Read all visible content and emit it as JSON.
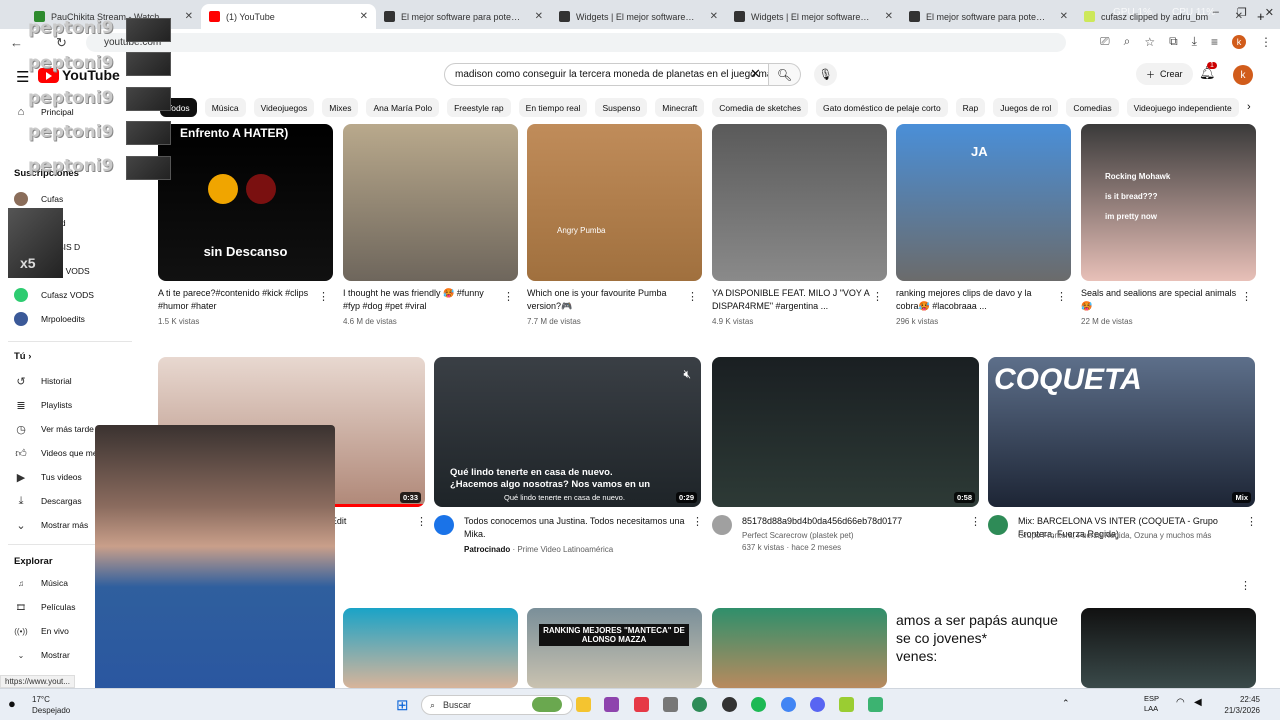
{
  "tabs": [
    {
      "title": "PauChikita Stream - Watch Live",
      "color": "#2e8b2e"
    },
    {
      "title": "(1) YouTube",
      "color": "#ff0000",
      "active": true
    },
    {
      "title": "El mejor software para potencia",
      "color": "#333333"
    },
    {
      "title": "Widgets | El mejor software pa",
      "color": "#333333"
    },
    {
      "title": "Widgets | El mejor software pa",
      "color": "#333333"
    },
    {
      "title": "El mejor software para potencia",
      "color": "#333333"
    },
    {
      "title": "cufasz clipped by adru_bm",
      "color": "#cde85a"
    }
  ],
  "overlay_stats": {
    "gpu": "GPU 1%",
    "cpu": "CPU 11%"
  },
  "address": {
    "url": "youtube.com",
    "profile": "k"
  },
  "header": {
    "logo_text": "YouTube",
    "search_value": "madison como conseguir la tercera moneda de planetas en el juego ma",
    "create_label": "Crear",
    "notif_count": "1",
    "avatar_letter": "k"
  },
  "chips": [
    "Todos",
    "Música",
    "Videojuegos",
    "Mixes",
    "Ana María Polo",
    "Freestyle rap",
    "En tiempo real",
    "Suspenso",
    "Minecraft",
    "Comedia de sketches",
    "Gato doméstico de pelaje corto",
    "Rap",
    "Juegos de rol",
    "Comedias",
    "Videojuego independiente"
  ],
  "sidebar": {
    "principal": "Principal",
    "subs_head": "Suscripciones",
    "subs": [
      "Cufas",
      "Speed",
      "TENSIS D",
      "Cufas VODS",
      "Cufasz VODS",
      "Mrpoloedits"
    ],
    "tu_head": "Tú",
    "tu": [
      "Historial",
      "Playlists",
      "Ver más tarde",
      "Videos que me gus...",
      "Tus videos",
      "Descargas",
      "Mostrar más"
    ],
    "explorar_head": "Explorar",
    "explorar": [
      "Música",
      "Películas",
      "En vivo",
      "Mostrar"
    ]
  },
  "shorts": [
    {
      "title": "A  ti te parece?#contenido #kick #clips #humor #hater",
      "views": "1.5 K vistas",
      "overlay_top": "Enfrento A HATER)",
      "overlay_bottom": "sin Descanso"
    },
    {
      "title": "I thought he was friendly 🥵 #funny #fyp #dog #pet #viral",
      "views": "4.6 M de vistas"
    },
    {
      "title": "Which one is your favourite Pumba version?🎮",
      "views": "7.7 M de vistas",
      "overlay": "Angry Pumba"
    },
    {
      "title": "YA DISPONIBLE FEAT. MILO J \"VOY A DISPAR4RME\" #argentina ...",
      "views": "4.9 K vistas"
    },
    {
      "title": "ranking mejores clips de davo y la cobra🥵 #lacobraaa ...",
      "views": "296 k vistas",
      "overlay": "JA"
    },
    {
      "title": "Seals and sealions are special animals 🥵",
      "views": "22 M de vistas",
      "overlay": [
        "Rocking Mohawk",
        "is it bread???",
        "im pretty now"
      ]
    }
  ],
  "videos": [
    {
      "title": "...) | Edit",
      "duration": "0:33"
    },
    {
      "title": "Todos conocemos una Justina. Todos necesitamos una Mika.",
      "sponsored": "Patrocinado",
      "channel": "Prime Video Latinoamérica",
      "duration": "0:29",
      "caption1": "Qué lindo tenerte en casa de nuevo.",
      "caption2": "¿Hacemos algo nosotras? Nos vamos en un",
      "caption3": "Qué lindo tenerte en casa de nuevo."
    },
    {
      "title": "85178d88a9bd4b0da456d66eb78d0177",
      "channel": "Perfect Scarecrow (plastek pet)",
      "meta": "637 k vistas · hace 2 meses",
      "duration": "0:58"
    },
    {
      "title": "Mix: BARCELONA VS INTER (COQUETA - Grupo Frontera, Fuerza Regida)",
      "channel": "Grupo Frontera, Fuerza Regida, Ozuna y muchos más",
      "duration": "Mix",
      "overlay": "COQUETA"
    }
  ],
  "row3_overlay": {
    "ranking": "RANKING MEJORES \"MANTECA\" DE ALONSO MAZZA",
    "text": "amos a ser papás aunque se co jovenes*",
    "text2": "venes:"
  },
  "streamer_overlay": {
    "name": "peptoni9",
    "badge": "x5"
  },
  "status_url": "https://www.yout...",
  "taskbar": {
    "search": "Buscar",
    "temp": "17°C",
    "weather": "Despejado",
    "lang1": "ESP",
    "lang2": "LAA",
    "time": "22:45",
    "date": "21/3/2026"
  }
}
